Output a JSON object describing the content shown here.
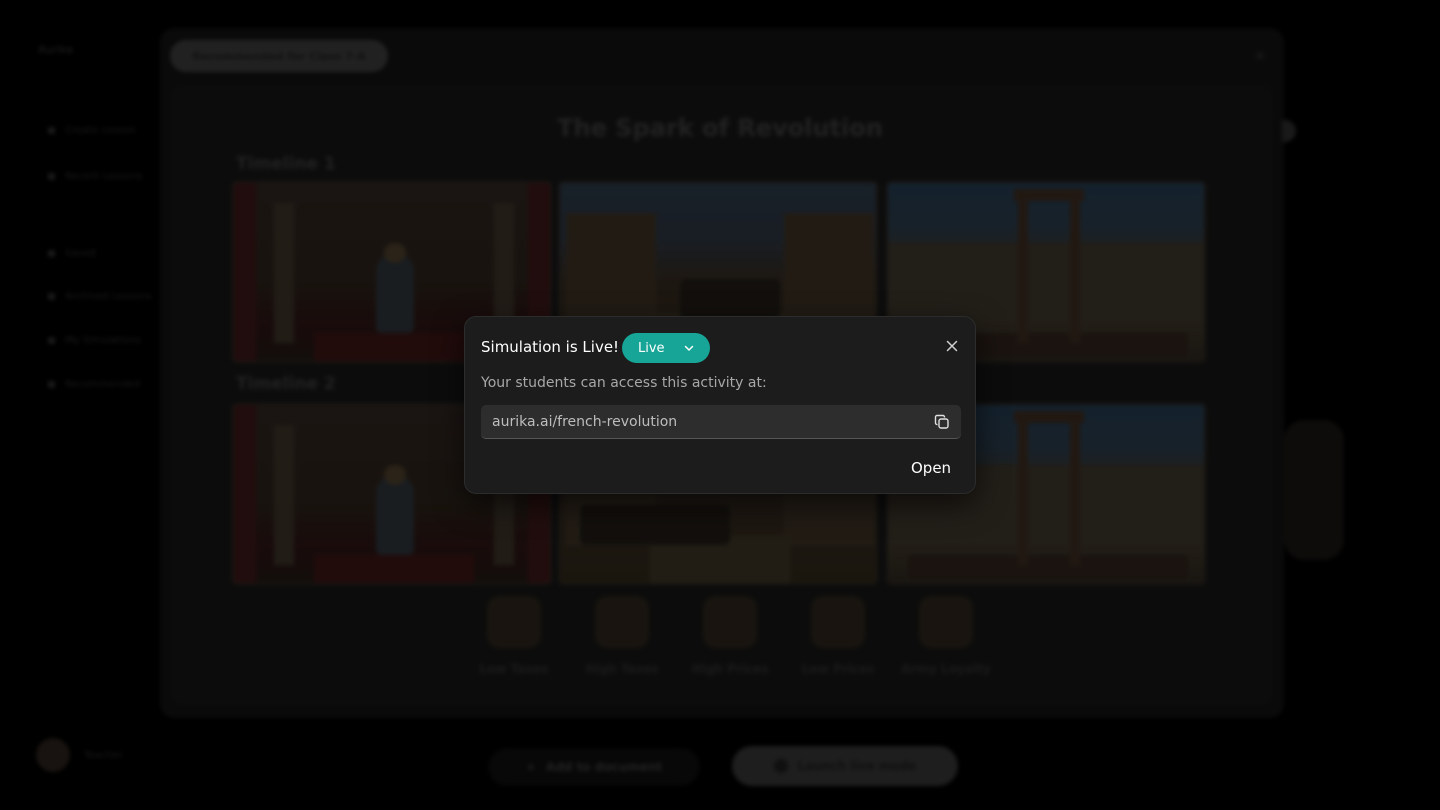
{
  "background": {
    "sidebar": {
      "brand": "Aurika",
      "items": [
        "Create Lesson",
        "Recent Lessons",
        "Saved",
        "Archived Lessons",
        "My Simulations",
        "Recommended"
      ],
      "user_name": "Teacher"
    },
    "recommendation_pill": "Recommended for Class 7-A",
    "activity_title": "The Spark of Revolution",
    "timelines": [
      {
        "label": "Timeline 1"
      },
      {
        "label": "Timeline 2"
      }
    ],
    "options": [
      "Low Taxes",
      "High Taxes",
      "High Prices",
      "Low Prices",
      "Army Loyalty"
    ],
    "add_to_document": "Add to document",
    "launch_live_mode": "Launch live mode",
    "close_icon": "x-icon"
  },
  "modal": {
    "title": "Simulation is Live!",
    "status_label": "Live",
    "status_color": "#17a597",
    "description": "Your students can access this activity at:",
    "url": "aurika.ai/french-revolution",
    "open_label": "Open",
    "close_icon": "close-icon",
    "copy_icon": "copy-icon",
    "dropdown_icon": "chevron-down-icon"
  }
}
